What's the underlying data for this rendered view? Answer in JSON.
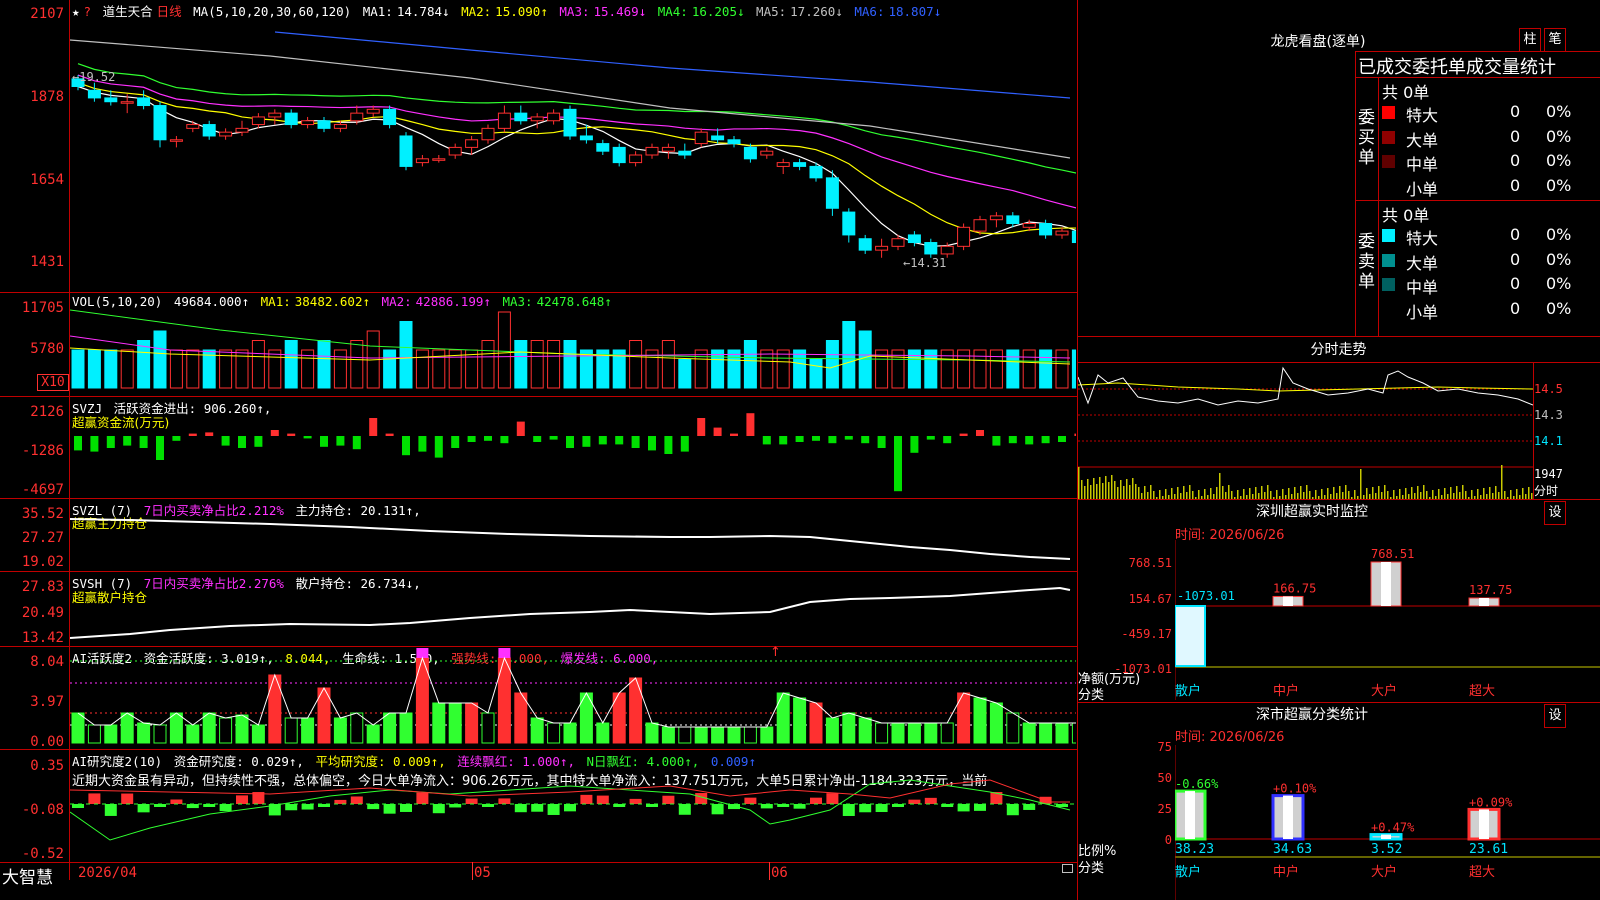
{
  "colors": {
    "up": "#ff3030",
    "down": "#00f0ff",
    "grid": "#c00000",
    "ma1": "#ffffff",
    "ma2": "#ffff00",
    "ma3": "#ff30ff",
    "ma4": "#30ff30",
    "ma5": "#c0c0c0",
    "ma6": "#3060ff"
  },
  "main": {
    "star": "★",
    "question": "?",
    "stock_name": "道生天合",
    "period": "日线",
    "ma_label": "MA(5,10,20,30,60,120)",
    "ma": [
      {
        "name": "MA1:",
        "value": "14.784↓"
      },
      {
        "name": "MA2:",
        "value": "15.090↑"
      },
      {
        "name": "MA3:",
        "value": "15.469↓"
      },
      {
        "name": "MA4:",
        "value": "16.205↓"
      },
      {
        "name": "MA5:",
        "value": "17.260↓"
      },
      {
        "name": "MA6:",
        "value": "18.807↓"
      }
    ],
    "axis": [
      "2107",
      "1878",
      "1654",
      "1431"
    ],
    "high_marker": "←19.52",
    "low_marker": "←14.31"
  },
  "vol": {
    "label": "VOL(5,10,20)",
    "value": "49684.000↑",
    "ma": [
      {
        "name": "MA1:",
        "value": "38482.602↑"
      },
      {
        "name": "MA2:",
        "value": "42886.199↑"
      },
      {
        "name": "MA3:",
        "value": "42478.648↑"
      }
    ],
    "axis": [
      "11705",
      "5780"
    ],
    "unit": "X10"
  },
  "svzj": {
    "label": "SVZJ",
    "text": "活跃资金进出: 906.260↑,",
    "subtitle": "超赢资金流(万元)",
    "axis": [
      "2126",
      "-1286",
      "-4697"
    ]
  },
  "svzl": {
    "label": "SVZL (7)",
    "text1": "7日内买卖净占比2.212%",
    "text2": "主力持仓: 20.131↑,",
    "subtitle": "超赢主力持仓",
    "axis": [
      "35.52",
      "27.27",
      "19.02"
    ]
  },
  "svsh": {
    "label": "SVSH (7)",
    "text1": "7日内买卖净占比2.276%",
    "text2": "散户持仓: 26.734↓,",
    "subtitle": "超赢散户持仓",
    "axis": [
      "27.83",
      "20.49",
      "13.42"
    ]
  },
  "ai1": {
    "label": "AI活跃度2",
    "t1": "资金活跃度: 3.019↑,",
    "t2": "8.044,",
    "t3": "生命线: 1.560,",
    "t4": "强势线: 3.000,",
    "t5": "爆发线: 6.000,",
    "arrow": "↑",
    "axis": [
      "8.04",
      "3.97",
      "0.00"
    ]
  },
  "ai2": {
    "label": "AI研究度2(10)",
    "t1": "资金研究度: 0.029↑,",
    "t2": "平均研究度: 0.009↑,",
    "t3": "连续飘红: 1.000↑,",
    "t4": "N日飘红: 4.000↑,",
    "t5": "0.009↑",
    "comment": "近期大资金虽有异动，但持续性不强，总体偏空，今日大单净流入：906.26万元，其中特大单净流入：137.751万元，大单5日累计净出-1184.323万元，当前",
    "axis": [
      "0.35",
      "-0.08",
      "-0.52"
    ]
  },
  "bottom": {
    "brand": "大智慧",
    "date1": "2026/04",
    "m1": "05",
    "m2": "06"
  },
  "dragon": {
    "title": "龙虎看盘(逐单)",
    "btn1": "柱",
    "btn2": "笔",
    "header": "已成交委托单成交量统计",
    "buy_label": "委买单",
    "sell_label": "委卖单",
    "buy_total": "共 0单",
    "sell_total": "共 0单",
    "buy_rows": [
      {
        "name": "特大",
        "n": "0",
        "p": "0%",
        "color": "#ff0000"
      },
      {
        "name": "大单",
        "n": "0",
        "p": "0%",
        "color": "#900000"
      },
      {
        "name": "中单",
        "n": "0",
        "p": "0%",
        "color": "#600000"
      },
      {
        "name": "小单",
        "n": "0",
        "p": "0%",
        "color": "#000000"
      }
    ],
    "sell_rows": [
      {
        "name": "特大",
        "n": "0",
        "p": "0%",
        "color": "#00f0ff"
      },
      {
        "name": "大单",
        "n": "0",
        "p": "0%",
        "color": "#009090"
      },
      {
        "name": "中单",
        "n": "0",
        "p": "0%",
        "color": "#006060"
      },
      {
        "name": "小单",
        "n": "0",
        "p": "0%",
        "color": "#000000"
      }
    ]
  },
  "intraday": {
    "title": "分时走势",
    "axis": [
      "14.5",
      "14.3",
      "14.1"
    ],
    "vol": "1947",
    "vol_unit": "分时"
  },
  "sz_monitor": {
    "title": "深圳超赢实时监控",
    "btn": "设",
    "time": "时间: 2026/06/26",
    "axis": [
      "768.51",
      "154.67",
      "-459.17",
      "-1073.01"
    ],
    "y_label": "净额(万元)",
    "x_label": "分类",
    "bars": [
      {
        "cat": "散户",
        "value": -1073.01,
        "label": "-1073.01"
      },
      {
        "cat": "中户",
        "value": 166.75,
        "label": "166.75"
      },
      {
        "cat": "大户",
        "value": 768.51,
        "label": "768.51"
      },
      {
        "cat": "超大",
        "value": 137.75,
        "label": "137.75"
      }
    ]
  },
  "sz_class": {
    "title": "深市超赢分类统计",
    "btn": "设",
    "time": "时间: 2026/06/26",
    "axis": [
      "75",
      "50",
      "25",
      "0"
    ],
    "y_label": "比例%",
    "x_label": "分类",
    "bars": [
      {
        "cat": "散户",
        "value": 38.23,
        "label": "38.23",
        "change": "-0.66%"
      },
      {
        "cat": "中户",
        "value": 34.63,
        "label": "34.63",
        "change": "+0.10%"
      },
      {
        "cat": "大户",
        "value": 3.52,
        "label": "3.52",
        "change": "+0.47%"
      },
      {
        "cat": "超大",
        "value": 23.61,
        "label": "23.61",
        "change": "+0.09%"
      }
    ]
  },
  "chart_data": [
    {
      "type": "candlestick",
      "title": "道生天合 日线",
      "ylim": [
        14.0,
        21.2
      ],
      "ohlc": [
        [
          19.6,
          19.7,
          19.3,
          19.4
        ],
        [
          19.3,
          19.5,
          19.0,
          19.1
        ],
        [
          19.1,
          19.3,
          18.9,
          19.0
        ],
        [
          19.0,
          19.2,
          18.7,
          19.0
        ],
        [
          19.1,
          19.3,
          18.8,
          18.9
        ],
        [
          18.9,
          19.0,
          17.8,
          18.0
        ],
        [
          18.0,
          18.1,
          17.8,
          18.0
        ],
        [
          18.3,
          18.5,
          18.2,
          18.4
        ],
        [
          18.4,
          18.5,
          18.0,
          18.1
        ],
        [
          18.1,
          18.3,
          18.0,
          18.2
        ],
        [
          18.2,
          18.5,
          18.1,
          18.3
        ],
        [
          18.4,
          18.7,
          18.3,
          18.6
        ],
        [
          18.6,
          18.8,
          18.4,
          18.7
        ],
        [
          18.7,
          18.8,
          18.3,
          18.4
        ],
        [
          18.4,
          18.6,
          18.3,
          18.5
        ],
        [
          18.5,
          18.6,
          18.2,
          18.3
        ],
        [
          18.3,
          18.5,
          18.2,
          18.4
        ],
        [
          18.5,
          18.9,
          18.4,
          18.7
        ],
        [
          18.7,
          18.9,
          18.6,
          18.8
        ],
        [
          18.8,
          18.9,
          18.3,
          18.4
        ],
        [
          18.1,
          18.2,
          17.2,
          17.3
        ],
        [
          17.4,
          17.6,
          17.3,
          17.5
        ],
        [
          17.5,
          17.6,
          17.4,
          17.5
        ],
        [
          17.6,
          17.9,
          17.5,
          17.8
        ],
        [
          17.8,
          18.1,
          17.6,
          18.0
        ],
        [
          18.0,
          18.4,
          17.9,
          18.3
        ],
        [
          18.3,
          18.9,
          18.2,
          18.7
        ],
        [
          18.7,
          18.9,
          18.4,
          18.5
        ],
        [
          18.5,
          18.7,
          18.3,
          18.6
        ],
        [
          18.5,
          18.8,
          18.4,
          18.7
        ],
        [
          18.8,
          18.9,
          18.0,
          18.1
        ],
        [
          18.1,
          18.4,
          17.9,
          18.0
        ],
        [
          17.9,
          18.0,
          17.6,
          17.7
        ],
        [
          17.8,
          17.9,
          17.3,
          17.4
        ],
        [
          17.4,
          17.7,
          17.3,
          17.6
        ],
        [
          17.6,
          17.9,
          17.5,
          17.8
        ],
        [
          17.7,
          17.9,
          17.5,
          17.8
        ],
        [
          17.7,
          17.9,
          17.5,
          17.6
        ],
        [
          17.9,
          18.3,
          17.8,
          18.2
        ],
        [
          18.1,
          18.3,
          17.9,
          18.0
        ],
        [
          18.0,
          18.1,
          17.8,
          17.9
        ],
        [
          17.8,
          17.9,
          17.4,
          17.5
        ],
        [
          17.6,
          17.8,
          17.5,
          17.7
        ],
        [
          17.3,
          17.5,
          17.1,
          17.4
        ],
        [
          17.4,
          17.5,
          17.2,
          17.3
        ],
        [
          17.3,
          17.4,
          16.9,
          17.0
        ],
        [
          17.0,
          17.2,
          16.0,
          16.2
        ],
        [
          16.1,
          16.2,
          15.3,
          15.5
        ],
        [
          15.4,
          15.5,
          15.0,
          15.1
        ],
        [
          15.1,
          15.4,
          14.9,
          15.2
        ],
        [
          15.2,
          15.5,
          15.1,
          15.4
        ],
        [
          15.5,
          15.6,
          15.2,
          15.3
        ],
        [
          15.3,
          15.4,
          14.9,
          15.0
        ],
        [
          15.0,
          15.3,
          14.9,
          15.2
        ],
        [
          15.2,
          15.8,
          15.1,
          15.7
        ],
        [
          15.6,
          16.0,
          15.5,
          15.9
        ],
        [
          15.9,
          16.1,
          15.7,
          16.0
        ],
        [
          16.0,
          16.1,
          15.7,
          15.8
        ],
        [
          15.7,
          15.9,
          15.6,
          15.8
        ],
        [
          15.8,
          15.9,
          15.4,
          15.5
        ],
        [
          15.5,
          15.7,
          15.4,
          15.6
        ],
        [
          15.6,
          15.7,
          15.2,
          15.3
        ],
        [
          15.3,
          15.4,
          15.0,
          15.1
        ],
        [
          15.1,
          15.2,
          14.9,
          15.0
        ],
        [
          15.0,
          15.2,
          14.9,
          15.1
        ]
      ]
    },
    {
      "type": "bar",
      "title": "VOL(5,10,20)",
      "values": [
        4,
        4,
        4,
        4,
        5,
        6,
        4,
        4,
        4,
        4,
        4,
        5,
        4,
        5,
        4,
        5,
        4,
        5,
        6,
        4,
        7,
        4,
        4,
        4,
        4,
        5,
        8,
        5,
        5,
        5,
        5,
        4,
        4,
        4,
        5,
        4,
        5,
        3,
        4,
        4,
        4,
        5,
        4,
        4,
        4,
        3,
        5,
        7,
        6,
        4,
        4,
        4,
        4,
        4,
        4,
        4,
        4,
        4,
        4,
        4,
        4,
        4,
        4,
        4,
        4
      ]
    },
    {
      "type": "bar",
      "title": "SVZJ",
      "values": [
        -1200,
        -1300,
        -1000,
        -800,
        -1000,
        -2000,
        -400,
        200,
        300,
        -800,
        -1000,
        -900,
        500,
        200,
        -200,
        -900,
        -800,
        -1100,
        1500,
        200,
        -1600,
        -1300,
        -1800,
        -1000,
        -500,
        -400,
        -600,
        1200,
        -500,
        -300,
        -1000,
        -900,
        -700,
        -700,
        -1000,
        -1200,
        -1500,
        -1300,
        1500,
        700,
        200,
        1900,
        -700,
        -700,
        -500,
        -400,
        -600,
        -300,
        -600,
        -1000,
        -4600,
        -1400,
        -300,
        -600,
        200,
        500,
        -800,
        -600,
        -700,
        -600,
        -500,
        200,
        -1000,
        -1000,
        800
      ]
    }
  ]
}
